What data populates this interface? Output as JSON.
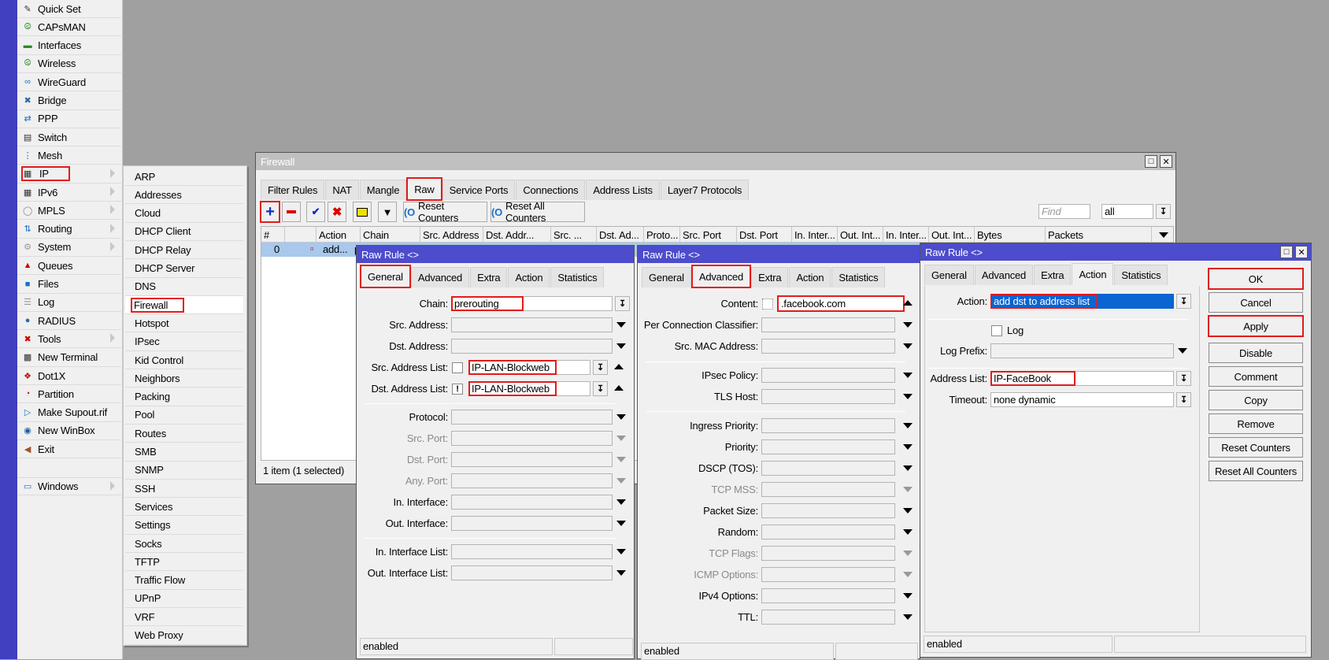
{
  "sidebar": {
    "items": [
      {
        "label": "Quick Set",
        "icon": "quick-set-icon",
        "submenu": false
      },
      {
        "label": "CAPsMAN",
        "icon": "capsman-icon",
        "submenu": false
      },
      {
        "label": "Interfaces",
        "icon": "interfaces-icon",
        "submenu": false
      },
      {
        "label": "Wireless",
        "icon": "wireless-icon",
        "submenu": false
      },
      {
        "label": "WireGuard",
        "icon": "wireguard-icon",
        "submenu": false
      },
      {
        "label": "Bridge",
        "icon": "bridge-icon",
        "submenu": false
      },
      {
        "label": "PPP",
        "icon": "ppp-icon",
        "submenu": false
      },
      {
        "label": "Switch",
        "icon": "switch-icon",
        "submenu": false
      },
      {
        "label": "Mesh",
        "icon": "mesh-icon",
        "submenu": false
      },
      {
        "label": "IP",
        "icon": "ip-icon",
        "submenu": true
      },
      {
        "label": "IPv6",
        "icon": "ipv6-icon",
        "submenu": true
      },
      {
        "label": "MPLS",
        "icon": "mpls-icon",
        "submenu": true
      },
      {
        "label": "Routing",
        "icon": "routing-icon",
        "submenu": true
      },
      {
        "label": "System",
        "icon": "system-icon",
        "submenu": true
      },
      {
        "label": "Queues",
        "icon": "queues-icon",
        "submenu": false
      },
      {
        "label": "Files",
        "icon": "files-icon",
        "submenu": false
      },
      {
        "label": "Log",
        "icon": "log-icon",
        "submenu": false
      },
      {
        "label": "RADIUS",
        "icon": "radius-icon",
        "submenu": false
      },
      {
        "label": "Tools",
        "icon": "tools-icon",
        "submenu": true
      },
      {
        "label": "New Terminal",
        "icon": "terminal-icon",
        "submenu": false
      },
      {
        "label": "Dot1X",
        "icon": "dot1x-icon",
        "submenu": false
      },
      {
        "label": "Partition",
        "icon": "partition-icon",
        "submenu": false
      },
      {
        "label": "Make Supout.rif",
        "icon": "supout-icon",
        "submenu": false
      },
      {
        "label": "New WinBox",
        "icon": "winbox-icon",
        "submenu": false
      },
      {
        "label": "Exit",
        "icon": "exit-icon",
        "submenu": false
      }
    ],
    "windows_label": "Windows"
  },
  "ip_submenu": {
    "items": [
      "ARP",
      "Addresses",
      "Cloud",
      "DHCP Client",
      "DHCP Relay",
      "DHCP Server",
      "DNS",
      "Firewall",
      "Hotspot",
      "IPsec",
      "Kid Control",
      "Neighbors",
      "Packing",
      "Pool",
      "Routes",
      "SMB",
      "SNMP",
      "SSH",
      "Services",
      "Settings",
      "Socks",
      "TFTP",
      "Traffic Flow",
      "UPnP",
      "VRF",
      "Web Proxy"
    ]
  },
  "firewall": {
    "title": "Firewall",
    "tabs": [
      "Filter Rules",
      "NAT",
      "Mangle",
      "Raw",
      "Service Ports",
      "Connections",
      "Address Lists",
      "Layer7 Protocols"
    ],
    "active_tab": "Raw",
    "toolbar": {
      "reset_counters": "Reset Counters",
      "reset_all_counters": "Reset All Counters",
      "find_placeholder": "Find",
      "filter_value": "all"
    },
    "columns": [
      "#",
      "",
      "Action",
      "Chain",
      "Src. Address",
      "Dst. Addr...",
      "Src. ...",
      "Dst. Ad...",
      "Proto...",
      "Src. Port",
      "Dst. Port",
      "In. Inter...",
      "Out. Int...",
      "In. Inter...",
      "Out. Int...",
      "Bytes",
      "Packets"
    ],
    "rows": [
      {
        "num": "0",
        "action": "add...",
        "chain": "p"
      }
    ],
    "status": "1 item (1 selected)"
  },
  "rule_general": {
    "title": "Raw Rule <>",
    "tabs": [
      "General",
      "Advanced",
      "Extra",
      "Action",
      "Statistics"
    ],
    "active_tab": "General",
    "fields": {
      "chain_label": "Chain:",
      "chain_value": "prerouting",
      "src_address_label": "Src. Address:",
      "dst_address_label": "Dst. Address:",
      "src_address_list_label": "Src. Address List:",
      "src_address_list_value": "IP-LAN-Blockweb",
      "dst_address_list_label": "Dst. Address List:",
      "dst_address_list_value": "IP-LAN-Blockweb",
      "dst_address_list_negate": "!",
      "protocol_label": "Protocol:",
      "src_port_label": "Src. Port:",
      "dst_port_label": "Dst. Port:",
      "any_port_label": "Any. Port:",
      "in_interface_label": "In. Interface:",
      "out_interface_label": "Out. Interface:",
      "in_interface_list_label": "In. Interface List:",
      "out_interface_list_label": "Out. Interface List:"
    },
    "status": "enabled"
  },
  "rule_advanced": {
    "title": "Raw Rule <>",
    "tabs": [
      "General",
      "Advanced",
      "Extra",
      "Action",
      "Statistics"
    ],
    "active_tab": "Advanced",
    "fields": {
      "content_label": "Content:",
      "content_value": ".facebook.com",
      "pcc_label": "Per Connection Classifier:",
      "src_mac_label": "Src. MAC Address:",
      "ipsec_policy_label": "IPsec Policy:",
      "tls_host_label": "TLS Host:",
      "ingress_priority_label": "Ingress Priority:",
      "priority_label": "Priority:",
      "dscp_label": "DSCP (TOS):",
      "tcp_mss_label": "TCP MSS:",
      "packet_size_label": "Packet Size:",
      "random_label": "Random:",
      "tcp_flags_label": "TCP Flags:",
      "icmp_options_label": "ICMP Options:",
      "ipv4_options_label": "IPv4 Options:",
      "ttl_label": "TTL:"
    },
    "status": "enabled"
  },
  "rule_action": {
    "title": "Raw Rule <>",
    "tabs": [
      "General",
      "Advanced",
      "Extra",
      "Action",
      "Statistics"
    ],
    "active_tab": "Action",
    "fields": {
      "action_label": "Action:",
      "action_value": "add dst to address list",
      "log_label": "Log",
      "log_prefix_label": "Log Prefix:",
      "address_list_label": "Address List:",
      "address_list_value": "IP-FaceBook",
      "timeout_label": "Timeout:",
      "timeout_value": "none dynamic"
    },
    "buttons": [
      "OK",
      "Cancel",
      "Apply",
      "Disable",
      "Comment",
      "Copy",
      "Remove",
      "Reset Counters",
      "Reset All Counters"
    ],
    "status": "enabled"
  },
  "colors": {
    "accent_blue": "#4c4ccc",
    "highlight_red": "#e31b1b",
    "selection_blue": "#0a64d2",
    "row_selected": "#a8c8ec"
  }
}
